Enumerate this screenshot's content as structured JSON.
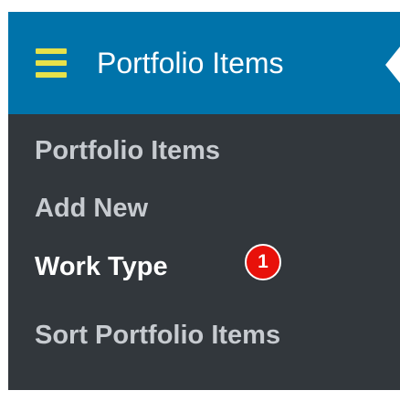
{
  "menu": {
    "title": "Portfolio Items",
    "icon": "hamburger-menu-icon",
    "items": [
      {
        "label": "Portfolio Items"
      },
      {
        "label": "Add New"
      },
      {
        "label": "Work Type",
        "badge": "1",
        "highlighted": true
      },
      {
        "label": "Sort Portfolio Items"
      }
    ]
  },
  "colors": {
    "header_background": "#0073aa",
    "menu_background": "#32373c",
    "icon_color": "#e6e14a",
    "badge_color": "#e8110a",
    "item_text": "#c7cbd0",
    "highlight_text": "#ffffff"
  }
}
